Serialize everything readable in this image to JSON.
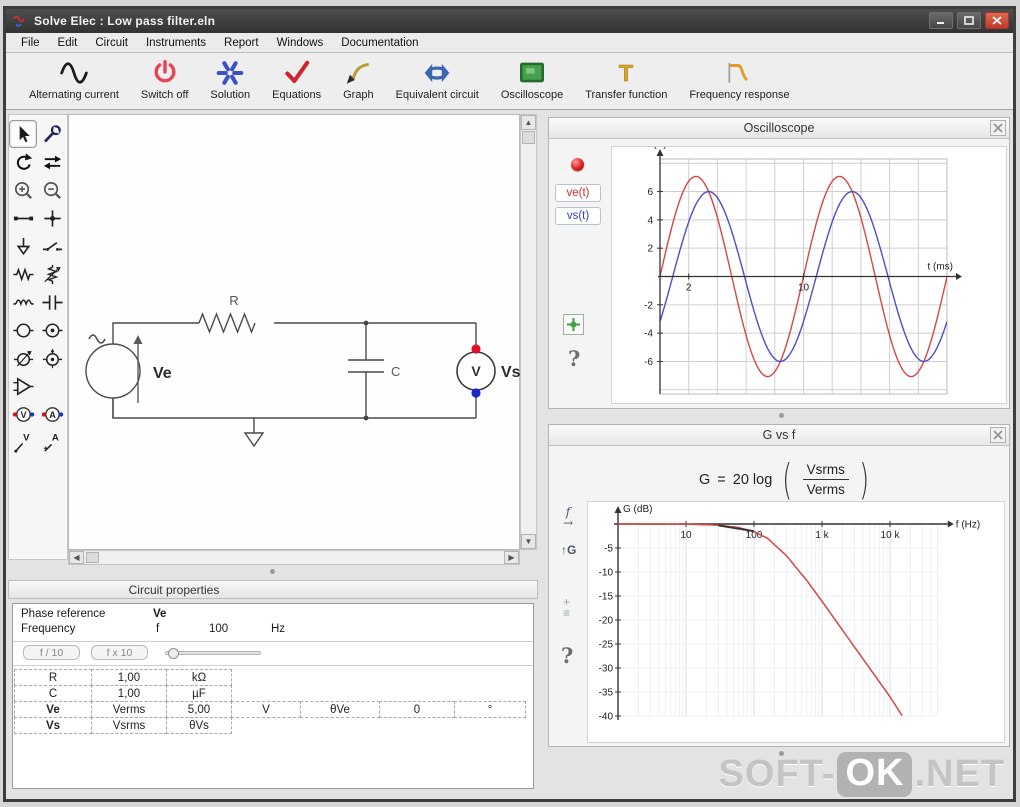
{
  "window": {
    "title": "Solve Elec : Low pass filter.eln"
  },
  "menu": {
    "items": [
      "File",
      "Edit",
      "Circuit",
      "Instruments",
      "Report",
      "Windows",
      "Documentation"
    ]
  },
  "toolbar": {
    "items": [
      {
        "label": "Alternating current",
        "icon": "sine-wave-icon"
      },
      {
        "label": "Switch off",
        "icon": "power-icon"
      },
      {
        "label": "Solution",
        "icon": "asterisk-icon"
      },
      {
        "label": "Equations",
        "icon": "checkmark-icon"
      },
      {
        "label": "Graph",
        "icon": "graph-arrow-icon"
      },
      {
        "label": "Equivalent circuit",
        "icon": "double-arrow-icon"
      },
      {
        "label": "Oscilloscope",
        "icon": "oscilloscope-screen-icon"
      },
      {
        "label": "Transfer function",
        "icon": "transfer-function-icon"
      },
      {
        "label": "Frequency response",
        "icon": "frequency-response-icon"
      }
    ]
  },
  "palette": {
    "tools": [
      "select",
      "wrench",
      "rotate",
      "reverse",
      "zoom-in",
      "zoom-out",
      "wire",
      "node",
      "ground",
      "switch",
      "resistor",
      "potentiometer",
      "inductor",
      "capacitor",
      "voltage-source",
      "current-source",
      "controlled-voltage-source",
      "controlled-current-source",
      "op-amp",
      "",
      "voltmeter",
      "ammeter",
      "voltage-probe",
      "current-probe"
    ],
    "selected": "select"
  },
  "circuit": {
    "resistor_label": "R",
    "capacitor_label": "C",
    "voltmeter_letter": "V",
    "source_label": "Ve",
    "output_label": "Vs"
  },
  "oscilloscope_panel": {
    "title": "Oscilloscope",
    "buttons": [
      {
        "label": "ve(t)",
        "color": "#cc3030"
      },
      {
        "label": "vs(t)",
        "color": "#3343c6"
      }
    ],
    "help": "?"
  },
  "gvsf_panel": {
    "title": "G vs f",
    "formula": {
      "lhs": "G",
      "eq": "=",
      "coef": "20 log",
      "paren_open": "(",
      "paren_close": ")",
      "num": "Vsrms",
      "den": "Verms"
    },
    "side_tools": {
      "f": "f",
      "g": "G"
    },
    "help": "?"
  },
  "properties_panel": {
    "title": "Circuit properties",
    "phase_reference": {
      "label": "Phase reference",
      "value": "Ve"
    },
    "frequency": {
      "label": "Frequency",
      "symbol": "f",
      "value": "100",
      "unit": "Hz"
    },
    "buttons": [
      "f / 10",
      "f x 10"
    ],
    "table": {
      "rows": [
        {
          "bold": false,
          "cells": [
            "R",
            "1,00",
            "kΩ"
          ]
        },
        {
          "bold": false,
          "cells": [
            "C",
            "1,00",
            "µF"
          ]
        },
        {
          "bold": true,
          "cells": [
            "Ve",
            "Verms",
            "5,00",
            "V",
            "θVe",
            "0",
            "°"
          ]
        },
        {
          "bold": true,
          "cells": [
            "Vs",
            "Vsrms",
            "θVs"
          ]
        }
      ]
    }
  },
  "watermark": {
    "part1": "SOFT-",
    "part2": "OK",
    "part3": ".NET"
  },
  "chart_data": [
    {
      "id": "oscilloscope",
      "type": "line",
      "title": "Oscilloscope",
      "xlabel": "t (ms)",
      "ylabel": "(V)",
      "xlim": [
        0,
        20
      ],
      "ylim": [
        -8.3,
        8.3
      ],
      "x_ticks": [
        2,
        10
      ],
      "y_ticks": [
        -6,
        -4,
        -2,
        2,
        4,
        6
      ],
      "grid": true,
      "grid_step_x": 2,
      "grid_step_y": 2,
      "series": [
        {
          "name": "ve(t)",
          "color": "#d84545",
          "waveform": "sine",
          "amplitude_V": 7.07,
          "period_ms": 10,
          "phase_deg": 0
        },
        {
          "name": "vs(t)",
          "color": "#4a4ecb",
          "waveform": "sine",
          "amplitude_V": 6.0,
          "period_ms": 10,
          "phase_deg": -32
        }
      ]
    },
    {
      "id": "gain_vs_frequency",
      "type": "line",
      "title": "G vs f",
      "xlabel": "f (Hz)",
      "ylabel": "G (dB)",
      "x_scale": "log",
      "xlim": [
        1,
        50000
      ],
      "ylim": [
        -40,
        0
      ],
      "x_ticks": [
        10,
        100,
        1000,
        10000
      ],
      "x_tick_labels": [
        "10",
        "100",
        "1 k",
        "10 k"
      ],
      "y_ticks": [
        -5,
        -10,
        -15,
        -20,
        -25,
        -30,
        -35,
        -40
      ],
      "grid": true,
      "series": [
        {
          "name": "G",
          "color": "#d84545",
          "points": [
            [
              1,
              0
            ],
            [
              10,
              -0.03
            ],
            [
              30,
              -0.25
            ],
            [
              60,
              -0.75
            ],
            [
              100,
              -1.6
            ],
            [
              159,
              -3
            ],
            [
              300,
              -6.6
            ],
            [
              600,
              -11.8
            ],
            [
              1000,
              -16.1
            ],
            [
              3000,
              -25.6
            ],
            [
              10000,
              -36.0
            ],
            [
              16000,
              -40.5
            ]
          ]
        }
      ],
      "cursor_frequency_hz": 100
    }
  ]
}
